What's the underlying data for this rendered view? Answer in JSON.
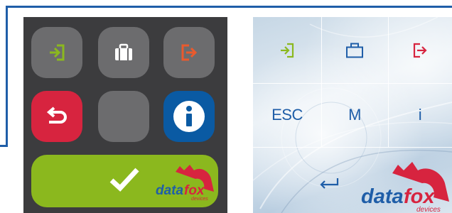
{
  "left_panel": {
    "keys": [
      {
        "name": "enter-key",
        "icon": "enter-arrow-icon",
        "bg": "#6c6c6e",
        "fg": "#8bb81e"
      },
      {
        "name": "briefcase-key",
        "icon": "briefcase-icon",
        "bg": "#6c6c6e",
        "fg": "#ffffff"
      },
      {
        "name": "exit-key",
        "icon": "exit-arrow-icon",
        "bg": "#6c6c6e",
        "fg": "#ea5a2d"
      },
      {
        "name": "back-key",
        "icon": "undo-arrow-icon",
        "bg": "#d7243f",
        "fg": "#ffffff"
      },
      {
        "name": "blank-key",
        "icon": "",
        "bg": "#6c6c6e",
        "fg": ""
      },
      {
        "name": "info-key",
        "icon": "info-icon",
        "bg": "#0a5aa3",
        "fg": "#ffffff"
      }
    ],
    "confirm": {
      "icon": "checkmark-icon",
      "bg": "#8bb81e"
    },
    "logo": {
      "brand": "datafox",
      "sub": "devices"
    }
  },
  "right_panel": {
    "keys": {
      "esc_label": "ESC",
      "m_label": "M",
      "i_label": "i"
    },
    "colors": {
      "enter": "#8bb81e",
      "briefcase": "#1f5ea8",
      "exit": "#d7243f",
      "text": "#1f5ea8"
    },
    "logo": {
      "brand": "datafox",
      "sub": "devices"
    }
  }
}
